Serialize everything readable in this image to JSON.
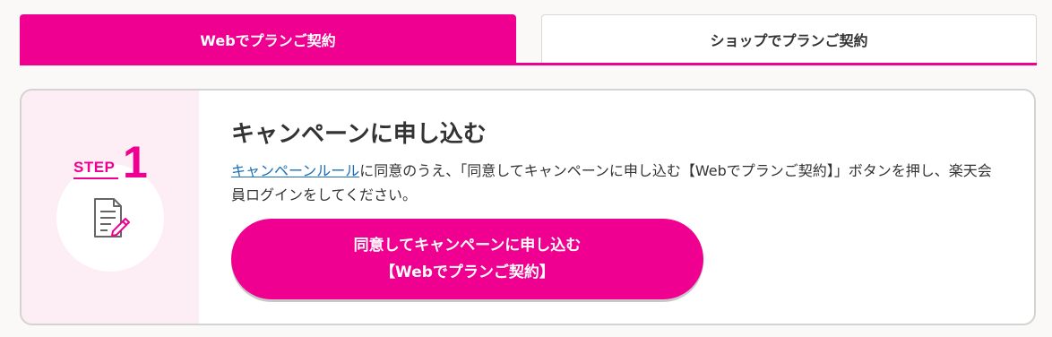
{
  "tabs": {
    "web_label": "Webでプランご契約",
    "shop_label": "ショップでプランご契約"
  },
  "step": {
    "word": "STEP",
    "number": "1",
    "icon": "document-pencil-icon"
  },
  "content": {
    "title": "キャンペーンに申し込む",
    "link_text": "キャンペーンルール",
    "desc_rest": "に同意のうえ、「同意してキャンペーンに申し込む【Webでプランご契約】」ボタンを押し、楽天会員ログインをしてください。"
  },
  "button": {
    "line1": "同意してキャンペーンに申し込む",
    "line2": "【Webでプランご契約】"
  },
  "colors": {
    "accent": "#ef0090",
    "step_bg": "#fdedf4",
    "link": "#1a6fb7",
    "text": "#333333"
  }
}
